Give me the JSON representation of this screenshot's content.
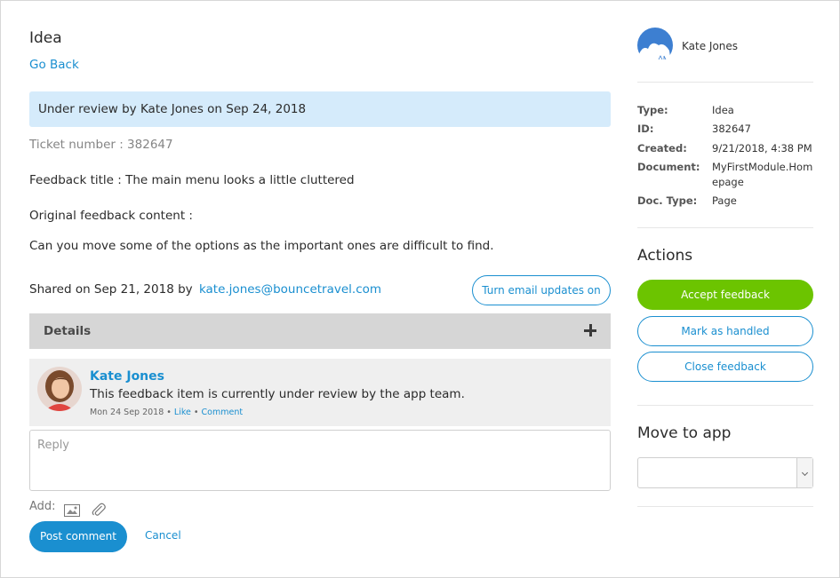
{
  "main": {
    "title": "Idea",
    "go_back": "Go Back",
    "status_banner": "Under review by Kate Jones on Sep 24, 2018",
    "ticket_number": "Ticket number : 382647",
    "feedback_title": "Feedback title : The main menu looks a little cluttered",
    "original_label": "Original feedback content :",
    "original_content": "Can you move some of the options as the important ones are difficult to find.",
    "shared_text": "Shared on Sep 21, 2018 by",
    "shared_email": "kate.jones@bouncetravel.com",
    "email_updates_button": "Turn email updates on",
    "details_label": "Details",
    "comment": {
      "author": "Kate Jones",
      "text": "This feedback item is currently under review by the app team.",
      "date": "Mon 24 Sep 2018",
      "separator": " • ",
      "like": "Like",
      "comment": "Comment"
    },
    "reply_placeholder": "Reply",
    "add_label": "Add:",
    "post_button": "Post comment",
    "cancel_link": "Cancel"
  },
  "side": {
    "user_name": "Kate Jones",
    "meta": {
      "type_label": "Type:",
      "type_value": "Idea",
      "id_label": "ID:",
      "id_value": "382647",
      "created_label": "Created:",
      "created_value": "9/21/2018, 4:38 PM",
      "document_label": "Document:",
      "document_value": "MyFirstModule.Homepage",
      "doctype_label": "Doc. Type:",
      "doctype_value": "Page"
    },
    "actions_title": "Actions",
    "accept_button": "Accept feedback",
    "handled_button": "Mark as handled",
    "close_button": "Close feedback",
    "move_title": "Move to app",
    "move_select_value": ""
  },
  "colors": {
    "accent": "#1a8fd0",
    "accept_green": "#6cc400",
    "banner_bg": "#d5ebfb",
    "details_bg": "#d6d6d6",
    "comment_bg": "#efefef"
  }
}
